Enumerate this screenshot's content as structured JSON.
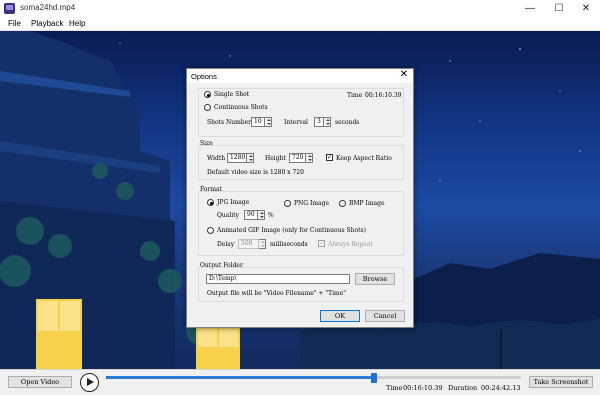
{
  "window": {
    "title": "soma24hd.mp4",
    "minimize": "—",
    "maximize": "☐",
    "close": "✕"
  },
  "menu": [
    "File",
    "Playback",
    "Help"
  ],
  "controls": {
    "open_video": "Open Video",
    "progress": 0.645,
    "time_label": "Time",
    "time_value": "00:16:10.39",
    "duration_label": "Duration",
    "duration_value": "00:24:42.13",
    "take_screenshot": "Take Screenshot"
  },
  "dialog": {
    "title": "Options",
    "close": "✕",
    "single_shot": {
      "label": "Single Shot",
      "selected": true,
      "time_label": "Time",
      "time_value": "00:16:10.39"
    },
    "continuous_shots": {
      "label": "Continuous Shots",
      "selected": false,
      "shots_number_label": "Shots Number",
      "shots_number": "10",
      "interval_label": "Interval",
      "interval": "3",
      "seconds_label": "seconds"
    },
    "size": {
      "legend": "Size",
      "width_label": "Width",
      "width": "1280",
      "height_label": "Height",
      "height": "720",
      "keep_aspect_label": "Keep Aspect Ratio",
      "keep_aspect": true,
      "default_note": "Default video size is 1280 x 720"
    },
    "format": {
      "legend": "Format",
      "jpg": "JPG Image",
      "png": "PNG Image",
      "bmp": "BMP Image",
      "selected": "JPG Image",
      "quality_label": "Quality",
      "quality": "90",
      "percent": "%",
      "gif_label": "Animated GIF Image (only for Continuous Shots)",
      "delay_label": "Delay",
      "delay": "500",
      "milliseconds": "milliseconds",
      "always_repeat": "Always Repeat"
    },
    "output": {
      "legend": "Output Folder",
      "path": "D:\\Temp\\",
      "browse": "Browse",
      "note": "Output file will be \"Video Filename\" + \"Time\""
    },
    "ok": "OK",
    "cancel": "Cancel"
  },
  "colors": {
    "accent": "#1c6fd6",
    "sky_top": "#0a1b52",
    "sky_mid": "#1d4ba2",
    "window_light": "#f7d14a"
  }
}
